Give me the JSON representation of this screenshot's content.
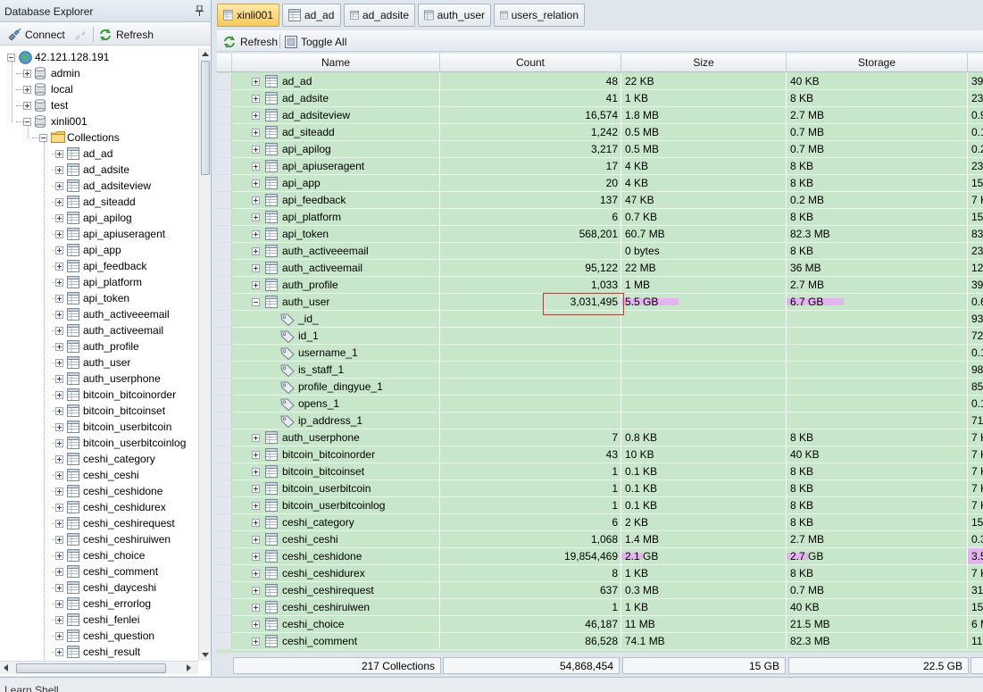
{
  "left_panel": {
    "title": "Database Explorer",
    "connect_label": "Connect",
    "refresh_label": "Refresh",
    "server": "42.121.128.191",
    "databases": [
      "admin",
      "local",
      "test",
      "xinli001"
    ],
    "collections_label": "Collections",
    "collections": [
      "ad_ad",
      "ad_adsite",
      "ad_adsiteview",
      "ad_siteadd",
      "api_apilog",
      "api_apiuseragent",
      "api_app",
      "api_feedback",
      "api_platform",
      "api_token",
      "auth_activeeemail",
      "auth_activeemail",
      "auth_profile",
      "auth_user",
      "auth_userphone",
      "bitcoin_bitcoinorder",
      "bitcoin_bitcoinset",
      "bitcoin_userbitcoin",
      "bitcoin_userbitcoinlog",
      "ceshi_category",
      "ceshi_ceshi",
      "ceshi_ceshidone",
      "ceshi_ceshidurex",
      "ceshi_ceshirequest",
      "ceshi_ceshiruiwen",
      "ceshi_choice",
      "ceshi_comment",
      "ceshi_dayceshi",
      "ceshi_errorlog",
      "ceshi_fenlei",
      "ceshi_question",
      "ceshi_result"
    ]
  },
  "tabs": [
    {
      "label": "xinli001",
      "active": true
    },
    {
      "label": "ad_ad",
      "active": false
    },
    {
      "label": "ad_adsite",
      "active": false
    },
    {
      "label": "auth_user",
      "active": false
    },
    {
      "label": "users_relation",
      "active": false
    }
  ],
  "toolbar": {
    "refresh_label": "Refresh",
    "toggle_label": "Toggle All"
  },
  "grid": {
    "columns": [
      "Name",
      "Count",
      "Size",
      "Storage"
    ],
    "rows": [
      {
        "type": "collection",
        "name": "ad_ad",
        "count": "48",
        "size": "22 KB",
        "storage": "40 KB",
        "extra": "39"
      },
      {
        "type": "collection",
        "name": "ad_adsite",
        "count": "41",
        "size": "1 KB",
        "storage": "8 KB",
        "extra": "23"
      },
      {
        "type": "collection",
        "name": "ad_adsiteview",
        "count": "16,574",
        "size": "1.8 MB",
        "storage": "2.7 MB",
        "extra": "0.9"
      },
      {
        "type": "collection",
        "name": "ad_siteadd",
        "count": "1,242",
        "size": "0.5 MB",
        "storage": "0.7 MB",
        "extra": "0.1"
      },
      {
        "type": "collection",
        "name": "api_apilog",
        "count": "3,217",
        "size": "0.5 MB",
        "storage": "0.7 MB",
        "extra": "0.2"
      },
      {
        "type": "collection",
        "name": "api_apiuseragent",
        "count": "17",
        "size": "4 KB",
        "storage": "8 KB",
        "extra": "23"
      },
      {
        "type": "collection",
        "name": "api_app",
        "count": "20",
        "size": "4 KB",
        "storage": "8 KB",
        "extra": "15"
      },
      {
        "type": "collection",
        "name": "api_feedback",
        "count": "137",
        "size": "47 KB",
        "storage": "0.2 MB",
        "extra": "7 K"
      },
      {
        "type": "collection",
        "name": "api_platform",
        "count": "6",
        "size": "0.7 KB",
        "storage": "8 KB",
        "extra": "15"
      },
      {
        "type": "collection",
        "name": "api_token",
        "count": "568,201",
        "size": "60.7 MB",
        "storage": "82.3 MB",
        "extra": "83"
      },
      {
        "type": "collection",
        "name": "auth_activeeemail",
        "count": "",
        "size": "0 bytes",
        "storage": "8 KB",
        "extra": "23"
      },
      {
        "type": "collection",
        "name": "auth_activeemail",
        "count": "95,122",
        "size": "22 MB",
        "storage": "36 MB",
        "extra": "12"
      },
      {
        "type": "collection",
        "name": "auth_profile",
        "count": "1,033",
        "size": "1 MB",
        "storage": "2.7 MB",
        "extra": "39"
      },
      {
        "type": "collection",
        "name": "auth_user",
        "count": "3,031,495",
        "size": "5.5 GB",
        "storage": "6.7 GB",
        "extra": "0.6",
        "expanded": true,
        "size_bar": 0.58,
        "storage_bar": 0.58
      },
      {
        "type": "index",
        "name": "_id_",
        "extra": "93"
      },
      {
        "type": "index",
        "name": "id_1",
        "extra": "72"
      },
      {
        "type": "index",
        "name": "username_1",
        "extra": "0.1"
      },
      {
        "type": "index",
        "name": "is_staff_1",
        "extra": "98"
      },
      {
        "type": "index",
        "name": "profile_dingyue_1",
        "extra": "85"
      },
      {
        "type": "index",
        "name": "opens_1",
        "extra": "0.1"
      },
      {
        "type": "index",
        "name": "ip_address_1",
        "extra": "71"
      },
      {
        "type": "collection",
        "name": "auth_userphone",
        "count": "7",
        "size": "0.8 KB",
        "storage": "8 KB",
        "extra": "7 K"
      },
      {
        "type": "collection",
        "name": "bitcoin_bitcoinorder",
        "count": "43",
        "size": "10 KB",
        "storage": "40 KB",
        "extra": "7 K"
      },
      {
        "type": "collection",
        "name": "bitcoin_bitcoinset",
        "count": "1",
        "size": "0.1 KB",
        "storage": "8 KB",
        "extra": "7 K"
      },
      {
        "type": "collection",
        "name": "bitcoin_userbitcoin",
        "count": "1",
        "size": "0.1 KB",
        "storage": "8 KB",
        "extra": "7 K"
      },
      {
        "type": "collection",
        "name": "bitcoin_userbitcoinlog",
        "count": "1",
        "size": "0.1 KB",
        "storage": "8 KB",
        "extra": "7 K"
      },
      {
        "type": "collection",
        "name": "ceshi_category",
        "count": "6",
        "size": "2 KB",
        "storage": "8 KB",
        "extra": "15"
      },
      {
        "type": "collection",
        "name": "ceshi_ceshi",
        "count": "1,068",
        "size": "1.4 MB",
        "storage": "2.7 MB",
        "extra": "0.3"
      },
      {
        "type": "collection",
        "name": "ceshi_ceshidone",
        "count": "19,854,469",
        "size": "2.1 GB",
        "storage": "2.7 GB",
        "extra": "3.5",
        "size_bar": 0.22,
        "storage_bar": 0.22,
        "extra_highlight": true
      },
      {
        "type": "collection",
        "name": "ceshi_ceshidurex",
        "count": "8",
        "size": "1 KB",
        "storage": "8 KB",
        "extra": "7 K"
      },
      {
        "type": "collection",
        "name": "ceshi_ceshirequest",
        "count": "637",
        "size": "0.3 MB",
        "storage": "0.7 MB",
        "extra": "31"
      },
      {
        "type": "collection",
        "name": "ceshi_ceshiruiwen",
        "count": "1",
        "size": "1 KB",
        "storage": "40 KB",
        "extra": "15"
      },
      {
        "type": "collection",
        "name": "ceshi_choice",
        "count": "46,187",
        "size": "11 MB",
        "storage": "21.5 MB",
        "extra": "6 M"
      },
      {
        "type": "collection",
        "name": "ceshi_comment",
        "count": "86,528",
        "size": "74.1 MB",
        "storage": "82.3 MB",
        "extra": "11"
      }
    ]
  },
  "footer": {
    "collections": "217 Collections",
    "count": "54,868,454",
    "size": "15 GB",
    "storage": "22.5 GB"
  },
  "bottom_strip": {
    "label": "Learn Shell"
  },
  "colors": {
    "row_bg": "#c8e6c9",
    "tab_active": "#f7c95b",
    "usage_bar": "#e2b3ee",
    "highlight_box": "#d03030"
  }
}
